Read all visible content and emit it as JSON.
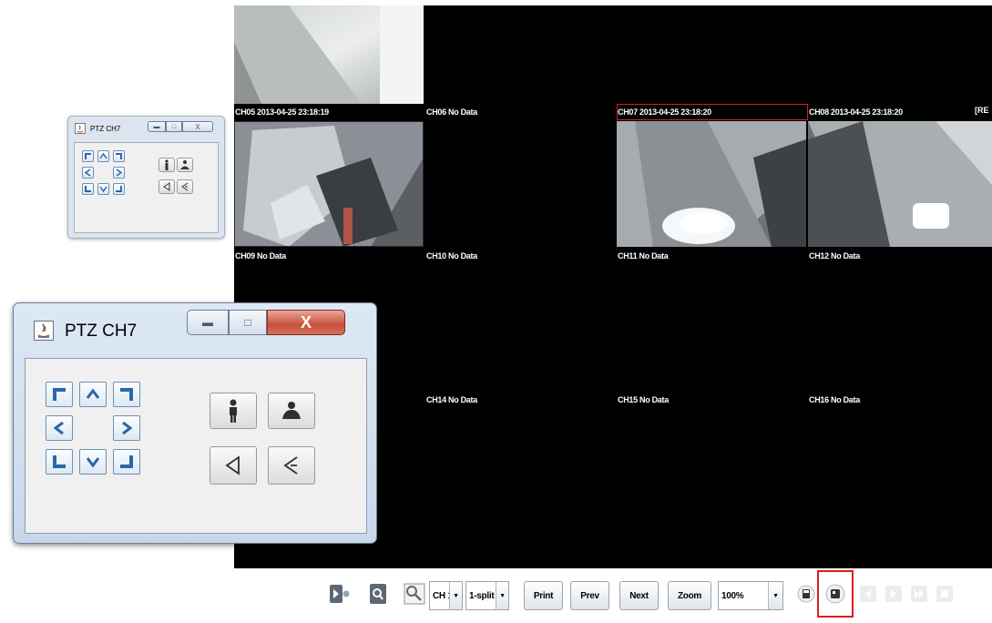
{
  "video_grid": {
    "tiles": [
      {
        "label": "CH05 2013-04-25 23:18:19"
      },
      {
        "label": "CH06 No Data"
      },
      {
        "label": "CH07 2013-04-25 23:18:20"
      },
      {
        "label": "CH08 2013-04-25 23:18:20"
      },
      {
        "label": "CH09 No Data"
      },
      {
        "label": "CH10 No Data"
      },
      {
        "label": "CH11 No Data"
      },
      {
        "label": "CH12 No Data"
      },
      {
        "label": "CH14 No Data"
      },
      {
        "label": "CH15 No Data"
      },
      {
        "label": "CH16 No Data"
      }
    ],
    "edge_label": "[RE",
    "selected_channel": "CH07",
    "selection_color": "#c0262c"
  },
  "ptz_small": {
    "title": "PTZ CH7"
  },
  "ptz_big": {
    "title": "PTZ CH7"
  },
  "ptz_controls": {
    "close_glyph": "X",
    "buttons": [
      "up-left-arrow-icon",
      "up-arrow-icon",
      "up-right-arrow-icon",
      "left-arrow-icon",
      "right-arrow-icon",
      "down-left-arrow-icon",
      "down-arrow-icon",
      "down-right-arrow-icon",
      "zoom-in-person-icon",
      "zoom-out-person-icon",
      "focus-near-icon",
      "focus-far-icon"
    ]
  },
  "toolbar": {
    "channel_select": "CH 1",
    "split_select": "1-split",
    "print_label": "Print",
    "prev_label": "Prev",
    "next_label": "Next",
    "zoom_label": "Zoom",
    "zoom_level": "100%",
    "highlight_color": "#e21b1b"
  }
}
